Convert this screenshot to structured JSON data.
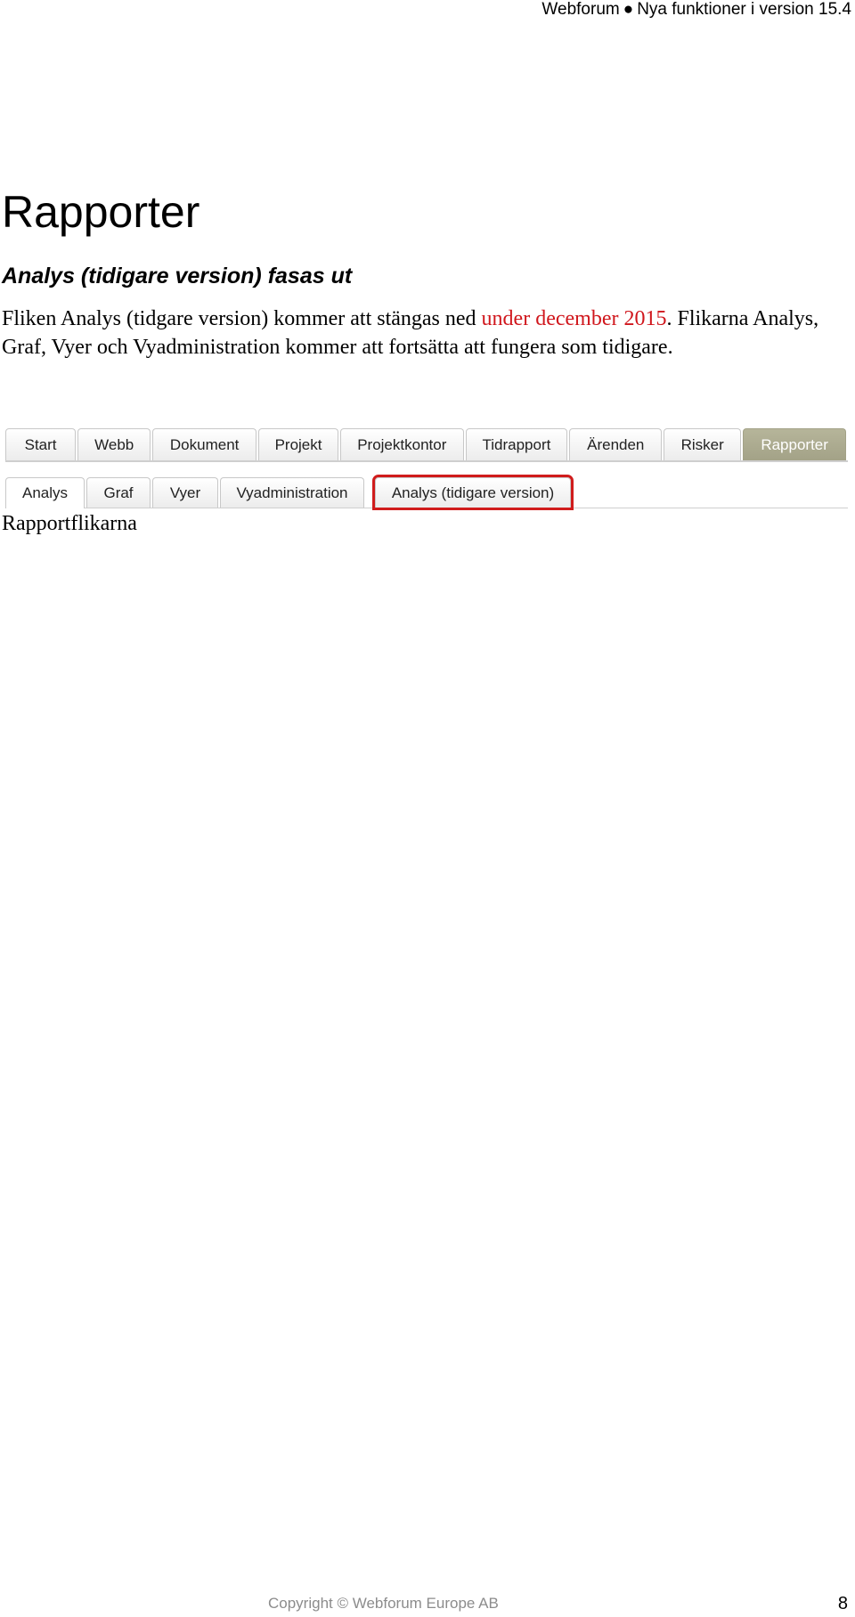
{
  "header": {
    "product": "Webforum",
    "bullet": "●",
    "subtitle": "Nya funktioner i version 15.4"
  },
  "heading": "Rapporter",
  "subheading": "Analys (tidigare version) fasas ut",
  "paragraph": {
    "part1": "Fliken Analys (tidgare version) kommer att stängas ned ",
    "highlight": "under december 2015",
    "part2": ". Flikarna Analys, Graf, Vyer och Vyadministration kommer att fortsätta att fungera som tidigare."
  },
  "main_tabs": [
    {
      "label": "Start"
    },
    {
      "label": "Webb"
    },
    {
      "label": "Dokument"
    },
    {
      "label": "Projekt"
    },
    {
      "label": "Projektkontor"
    },
    {
      "label": "Tidrapport"
    },
    {
      "label": "Ärenden"
    },
    {
      "label": "Risker"
    },
    {
      "label": "Rapporter",
      "active": true
    }
  ],
  "sub_tabs": [
    {
      "label": "Analys",
      "active": true
    },
    {
      "label": "Graf"
    },
    {
      "label": "Vyer"
    },
    {
      "label": "Vyadministration"
    },
    {
      "label": "Analys (tidigare version)",
      "highlighted": true
    }
  ],
  "caption": "Rapportflikarna",
  "footer": {
    "copyright": "Copyright © Webforum Europe AB",
    "page_number": "8"
  },
  "colors": {
    "highlight_text": "#d0161c",
    "active_tab": "#a3a287",
    "highlight_border": "#d01c1c"
  }
}
